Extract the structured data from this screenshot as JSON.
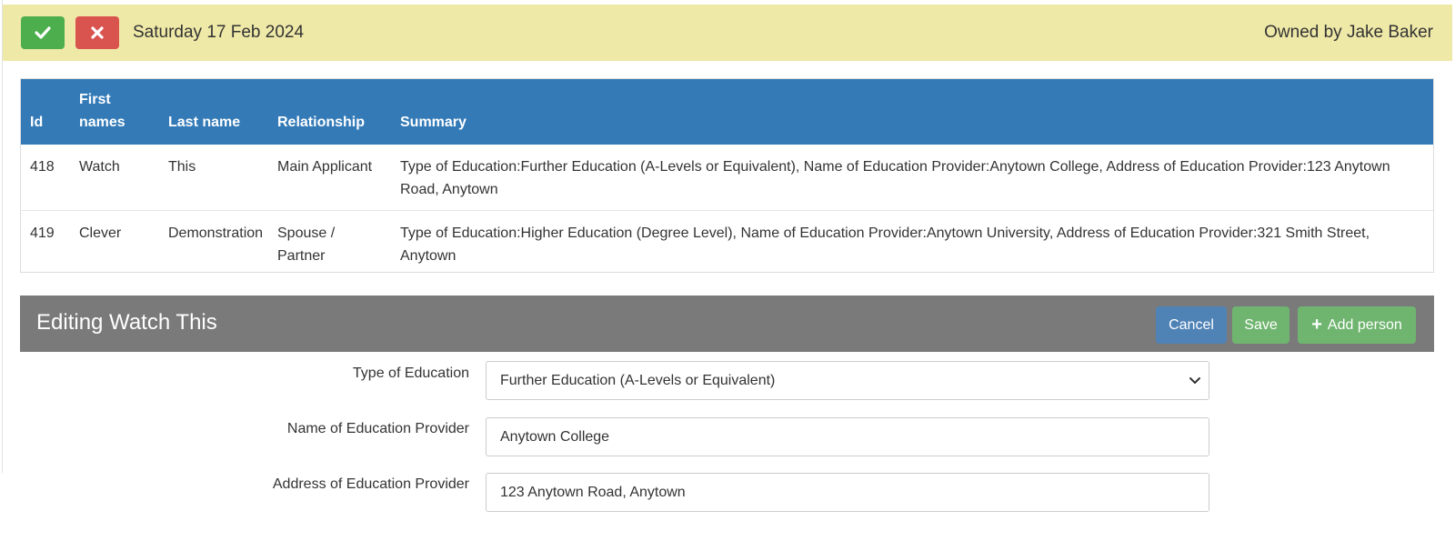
{
  "topbar": {
    "date": "Saturday 17 Feb 2024",
    "owner": "Owned by Jake Baker",
    "confirm_icon": "check-icon",
    "cancel_icon": "close-icon"
  },
  "table": {
    "headers": [
      "Id",
      "First names",
      "Last name",
      "Relationship",
      "Summary"
    ],
    "rows": [
      {
        "id": "418",
        "first": "Watch",
        "last": "This",
        "relationship": "Main Applicant",
        "summary": "Type of Education:Further Education (A-Levels or Equivalent), Name of Education Provider:Anytown College, Address of Education Provider:123 Anytown Road, Anytown"
      },
      {
        "id": "419",
        "first": "Clever",
        "last": "Demonstration",
        "relationship": "Spouse / Partner",
        "summary": "Type of Education:Higher Education (Degree Level), Name of Education Provider:Anytown University, Address of Education Provider:321 Smith Street, Anytown"
      }
    ]
  },
  "editor": {
    "title": "Editing Watch This",
    "cancel_label": "Cancel",
    "save_label": "Save",
    "add_label": "Add person",
    "fields": [
      {
        "label": "Type of Education",
        "value": "Further Education (A-Levels or Equivalent)"
      },
      {
        "label": "Name of Education Provider",
        "value": "Anytown College"
      },
      {
        "label": "Address of Education Provider",
        "value": "123 Anytown Road, Anytown"
      }
    ]
  },
  "colors": {
    "topbar_bg": "#efe9a8",
    "table_header": "#337ab7",
    "edit_header": "#7a7a7a",
    "success": "#4cae4c",
    "danger": "#d9534f"
  }
}
